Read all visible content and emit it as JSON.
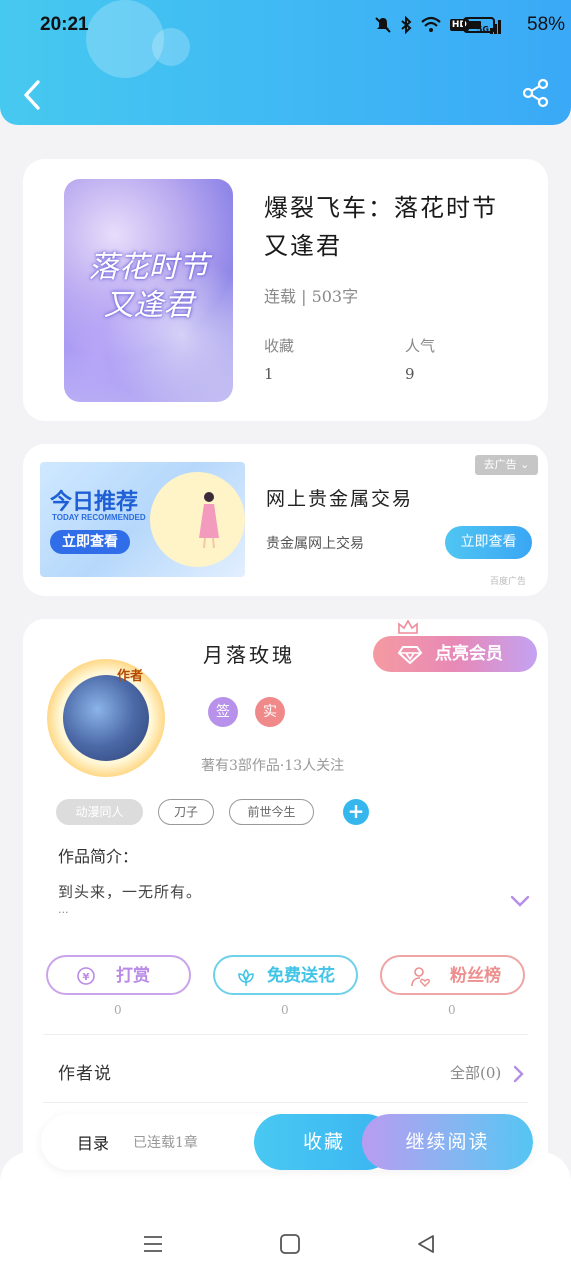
{
  "status_bar": {
    "time": "20:21",
    "battery": "58%",
    "net_labels": [
      "HD",
      "5G"
    ]
  },
  "book": {
    "title": "爆裂飞车：落花时节又逢君",
    "cover_text": "落花时节又逢君",
    "status": "连载 | 503字",
    "stats": [
      {
        "label": "收藏",
        "value": "1"
      },
      {
        "label": "人气",
        "value": "9"
      }
    ]
  },
  "ad": {
    "image_title": "今日推荐",
    "image_subtitle": "TODAY RECOMMENDED",
    "image_button": "立即查看",
    "close_label": "去广告",
    "title": "网上贵金属交易",
    "description": "贵金属网上交易",
    "button": "立即查看",
    "source": "百度广告"
  },
  "author": {
    "name": "月落玫瑰",
    "avatar_badge": "作者",
    "vip_button": "点亮会员",
    "badges": [
      {
        "text": "签",
        "color": "#b892ea"
      },
      {
        "text": "实",
        "color": "#f08a8a"
      }
    ],
    "meta": "著有3部作品·13人关注",
    "tags": [
      "动漫同人",
      "刀子",
      "前世今生"
    ],
    "intro_label": "作品简介：",
    "intro_text": "到头来，一无所有。",
    "intro_more": "...",
    "actions": [
      {
        "label": "打赏",
        "count": "0",
        "color": "#b98be6"
      },
      {
        "label": "免费送花",
        "count": "0",
        "color": "#41c4e6"
      },
      {
        "label": "粉丝榜",
        "count": "0",
        "color": "#ee8f8f"
      }
    ],
    "author_say": "作者说",
    "all_link": "全部(0)"
  },
  "bottom_bar": {
    "toc": "目录",
    "progress": "已连载1章",
    "collect": "收藏",
    "continue": "继续阅读"
  },
  "colors": {
    "header": "#3ab8f5",
    "accent": "#35b7ee"
  }
}
